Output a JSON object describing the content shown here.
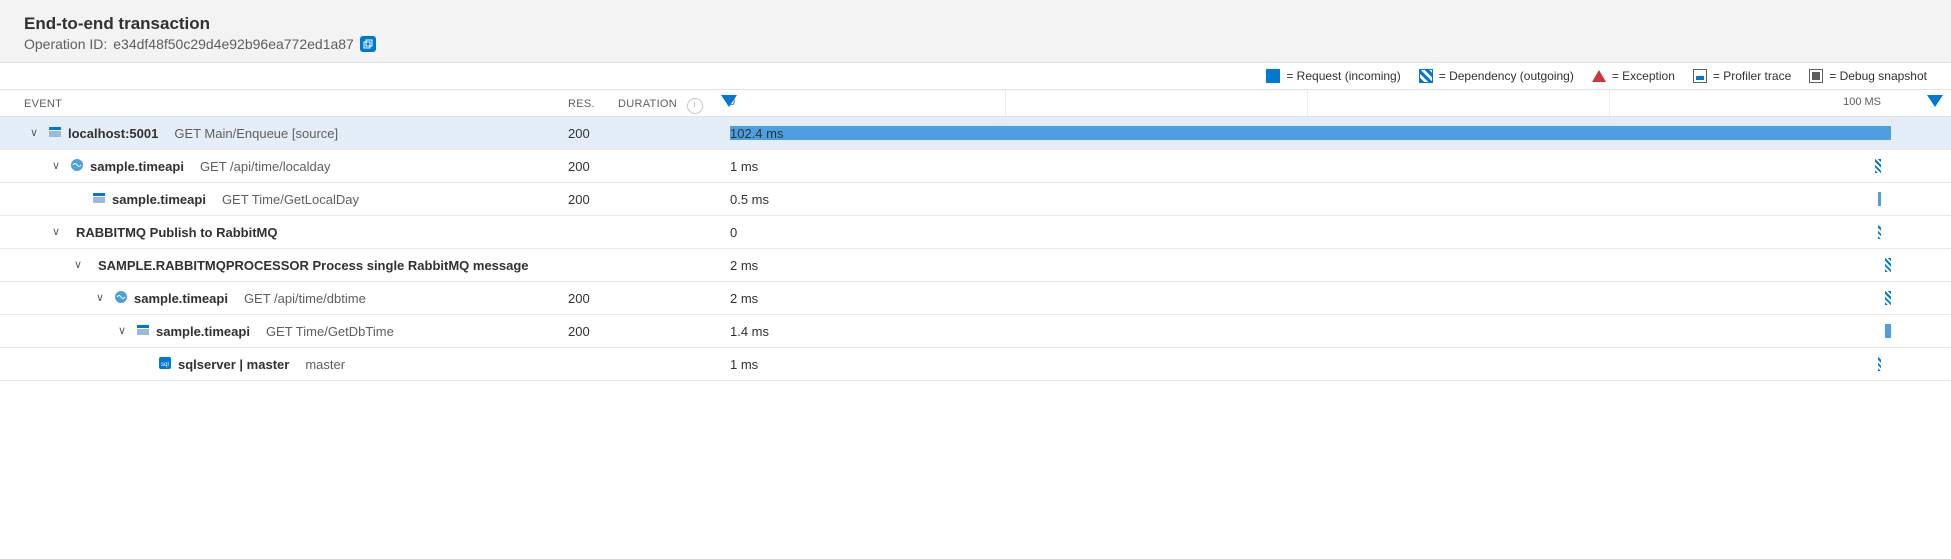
{
  "header": {
    "title": "End-to-end transaction",
    "operation_id_label": "Operation ID:",
    "operation_id": "e34df48f50c29d4e92b96ea772ed1a87"
  },
  "legend": {
    "request": "= Request (incoming)",
    "dependency": "= Dependency (outgoing)",
    "exception": "= Exception",
    "profiler": "= Profiler trace",
    "snapshot": "= Debug snapshot"
  },
  "columns": {
    "event": "Event",
    "res": "Res.",
    "duration": "Duration"
  },
  "timeline": {
    "start_label": "0",
    "end_label": "100 MS"
  },
  "rows": [
    {
      "indent": 0,
      "expand": true,
      "icon": "request",
      "service": "localhost:5001",
      "op": "GET Main/Enqueue [source]",
      "res": "200",
      "dur": "102.4 ms",
      "bar": {
        "left": 0,
        "width": 98,
        "type": "req-full"
      },
      "selected": true
    },
    {
      "indent": 1,
      "expand": true,
      "icon": "dependency",
      "service": "sample.timeapi",
      "op": "GET /api/time/localday",
      "res": "200",
      "dur": "1 ms",
      "bar": {
        "right": 1,
        "type": "dep"
      }
    },
    {
      "indent": 2,
      "expand": false,
      "icon": "request",
      "service": "sample.timeapi",
      "op": "GET Time/GetLocalDay",
      "res": "200",
      "dur": "0.5 ms",
      "bar": {
        "right": 1,
        "type": "req-thin"
      }
    },
    {
      "indent": 1,
      "expand": true,
      "icon": "none",
      "service": "RABBITMQ",
      "op_join": "Publish to RabbitMQ",
      "res": "",
      "dur": "0",
      "bar": {
        "right": 1,
        "type": "dep-thin"
      }
    },
    {
      "indent": 2,
      "expand": true,
      "icon": "none",
      "service": "SAMPLE.RABBITMQPROCESSOR",
      "op_join": "Process single RabbitMQ message",
      "res": "",
      "dur": "2 ms",
      "bar": {
        "right": 0,
        "type": "dep"
      }
    },
    {
      "indent": 3,
      "expand": true,
      "icon": "dependency",
      "service": "sample.timeapi",
      "op": "GET /api/time/dbtime",
      "res": "200",
      "dur": "2 ms",
      "bar": {
        "right": 0,
        "type": "dep"
      }
    },
    {
      "indent": 4,
      "expand": true,
      "icon": "request",
      "service": "sample.timeapi",
      "op": "GET Time/GetDbTime",
      "res": "200",
      "dur": "1.4 ms",
      "bar": {
        "right": 0,
        "type": "req"
      }
    },
    {
      "indent": 5,
      "expand": false,
      "icon": "sql",
      "service": "sqlserver | master",
      "op": "master",
      "res": "",
      "dur": "1 ms",
      "bar": {
        "right": 1,
        "type": "dep-thin"
      }
    }
  ]
}
